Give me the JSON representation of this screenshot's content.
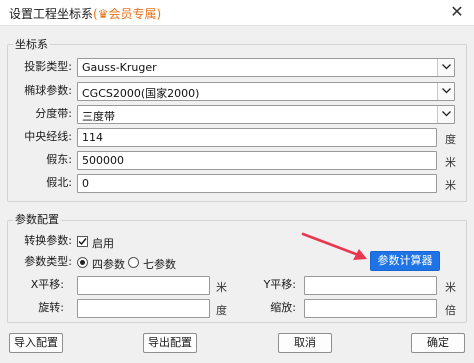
{
  "window": {
    "title": "设置工程坐标系",
    "badge": "(♛会员专属)",
    "close_glyph": "✕"
  },
  "coord_group": {
    "title": "坐标系",
    "projection": {
      "label": "投影类型:",
      "value": "Gauss-Kruger"
    },
    "ellipsoid": {
      "label": "椭球参数:",
      "value": "CGCS2000(国家2000)"
    },
    "zone": {
      "label": "分度带:",
      "value": "三度带"
    },
    "central_meridian": {
      "label": "中央经线:",
      "value": "114",
      "unit": "度"
    },
    "false_east": {
      "label": "假东:",
      "value": "500000",
      "unit": "米"
    },
    "false_north": {
      "label": "假北:",
      "value": "0",
      "unit": "米"
    }
  },
  "param_group": {
    "title": "参数配置",
    "convert": {
      "label": "转换参数:",
      "option": "启用",
      "checked": true
    },
    "param_type": {
      "label": "参数类型:",
      "option4": "四参数",
      "option7": "七参数",
      "selected": "四参数"
    },
    "calc_button": "参数计算器",
    "x_shift": {
      "label": "X平移:",
      "value": "",
      "unit": "米"
    },
    "y_shift": {
      "label": "Y平移:",
      "value": "",
      "unit": "米"
    },
    "rotation": {
      "label": "旋转:",
      "value": "",
      "unit": "度"
    },
    "scale": {
      "label": "缩放:",
      "value": "",
      "unit": "倍"
    }
  },
  "footer": {
    "import": "导入配置",
    "export": "导出配置",
    "cancel": "取消",
    "ok": "确定"
  },
  "colors": {
    "accent": "#1e74e6",
    "arrow": "#e8384f",
    "vip": "#e8731a"
  }
}
